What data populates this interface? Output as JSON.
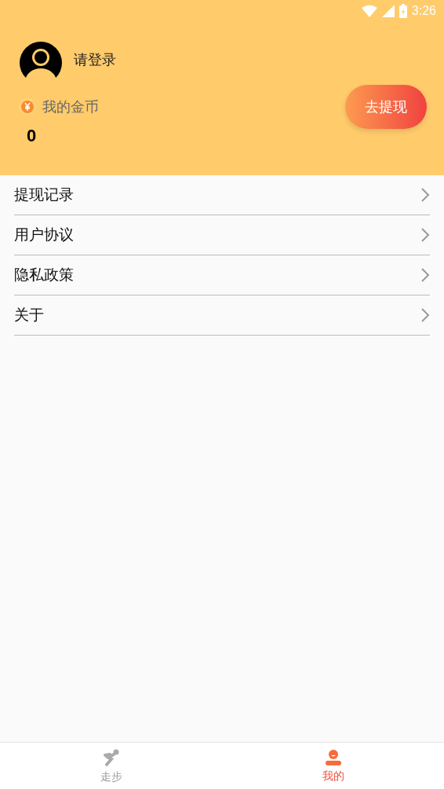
{
  "status_bar": {
    "time": "3:26"
  },
  "profile": {
    "login_prompt": "请登录",
    "coins_label": "我的金币",
    "coins": "0",
    "withdraw_button": "去提现"
  },
  "menu": [
    {
      "label": "提现记录"
    },
    {
      "label": "用户协议"
    },
    {
      "label": "隐私政策"
    },
    {
      "label": "关于"
    }
  ],
  "tabs": [
    {
      "label": "走步",
      "kind": "walk",
      "selected": false
    },
    {
      "label": "我的",
      "kind": "me",
      "selected": true
    }
  ]
}
